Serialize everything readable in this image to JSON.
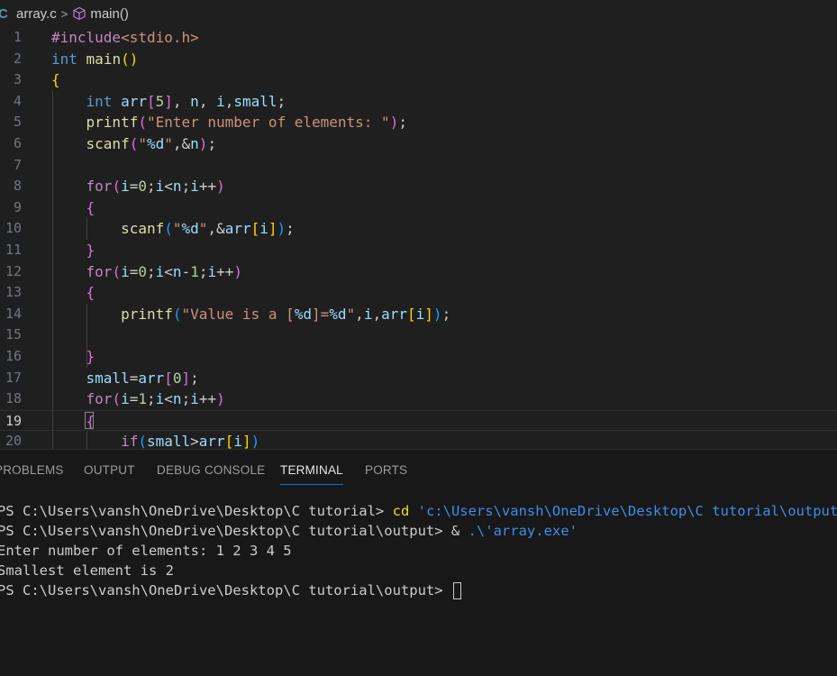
{
  "breadcrumb": {
    "lang_icon": "C",
    "file": "array.c",
    "separator": ">",
    "symbol_icon": "cube-icon",
    "symbol": "main()"
  },
  "editor": {
    "current_line": 19,
    "lines": [
      {
        "n": "1"
      },
      {
        "n": "2"
      },
      {
        "n": "3"
      },
      {
        "n": "4"
      },
      {
        "n": "5"
      },
      {
        "n": "6"
      },
      {
        "n": "7"
      },
      {
        "n": "8"
      },
      {
        "n": "9"
      },
      {
        "n": "10"
      },
      {
        "n": "11"
      },
      {
        "n": "12"
      },
      {
        "n": "13"
      },
      {
        "n": "14"
      },
      {
        "n": "15"
      },
      {
        "n": "16"
      },
      {
        "n": "17"
      },
      {
        "n": "18"
      },
      {
        "n": "19"
      },
      {
        "n": "20"
      }
    ],
    "code": [
      [
        {
          "t": "#include",
          "c": "pp"
        },
        {
          "t": "<stdio.h>",
          "c": "str"
        }
      ],
      [
        {
          "t": "int",
          "c": "kw"
        },
        {
          "t": " "
        },
        {
          "t": "main",
          "c": "fn"
        },
        {
          "t": "()",
          "c": "p1"
        }
      ],
      [
        {
          "t": "{",
          "c": "p1"
        }
      ],
      [
        {
          "t": "    "
        },
        {
          "t": "int",
          "c": "kw"
        },
        {
          "t": " "
        },
        {
          "t": "arr",
          "c": "var"
        },
        {
          "t": "[",
          "c": "p2"
        },
        {
          "t": "5",
          "c": "num"
        },
        {
          "t": "]",
          "c": "p2"
        },
        {
          "t": ", "
        },
        {
          "t": "n",
          "c": "var"
        },
        {
          "t": ", "
        },
        {
          "t": "i",
          "c": "var"
        },
        {
          "t": ","
        },
        {
          "t": "small",
          "c": "var"
        },
        {
          "t": ";"
        }
      ],
      [
        {
          "t": "    "
        },
        {
          "t": "printf",
          "c": "fn"
        },
        {
          "t": "(",
          "c": "p2"
        },
        {
          "t": "\"Enter number of elements: \"",
          "c": "str"
        },
        {
          "t": ")",
          "c": "p2"
        },
        {
          "t": ";"
        }
      ],
      [
        {
          "t": "    "
        },
        {
          "t": "scanf",
          "c": "fn"
        },
        {
          "t": "(",
          "c": "p2"
        },
        {
          "t": "\"",
          "c": "str"
        },
        {
          "t": "%d",
          "c": "esc"
        },
        {
          "t": "\"",
          "c": "str"
        },
        {
          "t": ",&"
        },
        {
          "t": "n",
          "c": "var"
        },
        {
          "t": ")",
          "c": "p2"
        },
        {
          "t": ";"
        }
      ],
      [],
      [
        {
          "t": "    "
        },
        {
          "t": "for",
          "c": "pp"
        },
        {
          "t": "(",
          "c": "p2"
        },
        {
          "t": "i",
          "c": "var"
        },
        {
          "t": "="
        },
        {
          "t": "0",
          "c": "num"
        },
        {
          "t": ";"
        },
        {
          "t": "i",
          "c": "var"
        },
        {
          "t": "<"
        },
        {
          "t": "n",
          "c": "var"
        },
        {
          "t": ";"
        },
        {
          "t": "i",
          "c": "var"
        },
        {
          "t": "++"
        },
        {
          "t": ")",
          "c": "p2"
        }
      ],
      [
        {
          "t": "    "
        },
        {
          "t": "{",
          "c": "p2"
        }
      ],
      [
        {
          "t": "        "
        },
        {
          "t": "scanf",
          "c": "fn"
        },
        {
          "t": "(",
          "c": "p3"
        },
        {
          "t": "\"",
          "c": "str"
        },
        {
          "t": "%d",
          "c": "esc"
        },
        {
          "t": "\"",
          "c": "str"
        },
        {
          "t": ",&"
        },
        {
          "t": "arr",
          "c": "var"
        },
        {
          "t": "[",
          "c": "p1"
        },
        {
          "t": "i",
          "c": "var"
        },
        {
          "t": "]",
          "c": "p1"
        },
        {
          "t": ")",
          "c": "p3"
        },
        {
          "t": ";"
        }
      ],
      [
        {
          "t": "    "
        },
        {
          "t": "}",
          "c": "p2"
        }
      ],
      [
        {
          "t": "    "
        },
        {
          "t": "for",
          "c": "pp"
        },
        {
          "t": "(",
          "c": "p2"
        },
        {
          "t": "i",
          "c": "var"
        },
        {
          "t": "="
        },
        {
          "t": "0",
          "c": "num"
        },
        {
          "t": ";"
        },
        {
          "t": "i",
          "c": "var"
        },
        {
          "t": "<"
        },
        {
          "t": "n",
          "c": "var"
        },
        {
          "t": "-"
        },
        {
          "t": "1",
          "c": "num"
        },
        {
          "t": ";"
        },
        {
          "t": "i",
          "c": "var"
        },
        {
          "t": "++"
        },
        {
          "t": ")",
          "c": "p2"
        }
      ],
      [
        {
          "t": "    "
        },
        {
          "t": "{",
          "c": "p2"
        }
      ],
      [
        {
          "t": "        "
        },
        {
          "t": "printf",
          "c": "fn"
        },
        {
          "t": "(",
          "c": "p3"
        },
        {
          "t": "\"Value is a [",
          "c": "str"
        },
        {
          "t": "%d",
          "c": "esc"
        },
        {
          "t": "]=",
          "c": "str"
        },
        {
          "t": "%d",
          "c": "esc"
        },
        {
          "t": "\"",
          "c": "str"
        },
        {
          "t": ","
        },
        {
          "t": "i",
          "c": "var"
        },
        {
          "t": ","
        },
        {
          "t": "arr",
          "c": "var"
        },
        {
          "t": "[",
          "c": "p1"
        },
        {
          "t": "i",
          "c": "var"
        },
        {
          "t": "]",
          "c": "p1"
        },
        {
          "t": ")",
          "c": "p3"
        },
        {
          "t": ";"
        }
      ],
      [],
      [
        {
          "t": "    "
        },
        {
          "t": "}",
          "c": "p2"
        }
      ],
      [
        {
          "t": "    "
        },
        {
          "t": "small",
          "c": "var"
        },
        {
          "t": "="
        },
        {
          "t": "arr",
          "c": "var"
        },
        {
          "t": "[",
          "c": "p2"
        },
        {
          "t": "0",
          "c": "num"
        },
        {
          "t": "]",
          "c": "p2"
        },
        {
          "t": ";"
        }
      ],
      [
        {
          "t": "    "
        },
        {
          "t": "for",
          "c": "pp"
        },
        {
          "t": "(",
          "c": "p2"
        },
        {
          "t": "i",
          "c": "var"
        },
        {
          "t": "="
        },
        {
          "t": "1",
          "c": "num"
        },
        {
          "t": ";"
        },
        {
          "t": "i",
          "c": "var"
        },
        {
          "t": "<"
        },
        {
          "t": "n",
          "c": "var"
        },
        {
          "t": ";"
        },
        {
          "t": "i",
          "c": "var"
        },
        {
          "t": "++"
        },
        {
          "t": ")",
          "c": "p2"
        }
      ],
      [
        {
          "t": "    "
        },
        {
          "t": "{",
          "c": "p2"
        }
      ],
      [
        {
          "t": "        "
        },
        {
          "t": "if",
          "c": "pp"
        },
        {
          "t": "(",
          "c": "p3"
        },
        {
          "t": "small",
          "c": "var"
        },
        {
          "t": ">"
        },
        {
          "t": "arr",
          "c": "var"
        },
        {
          "t": "[",
          "c": "p1"
        },
        {
          "t": "i",
          "c": "var"
        },
        {
          "t": "]",
          "c": "p1"
        },
        {
          "t": ")",
          "c": "p3"
        }
      ]
    ]
  },
  "panel": {
    "tabs": [
      {
        "label": "PROBLEMS",
        "name": "tab-problems"
      },
      {
        "label": "OUTPUT",
        "name": "tab-output"
      },
      {
        "label": "DEBUG CONSOLE",
        "name": "tab-debug-console"
      },
      {
        "label": "TERMINAL",
        "name": "tab-terminal",
        "active": true
      },
      {
        "label": "PORTS",
        "name": "tab-ports"
      }
    ],
    "terminal": {
      "line1_prompt": "PS C:\\Users\\vansh\\OneDrive\\Desktop\\C tutorial> ",
      "line1_cmd": "cd",
      "line1_arg": " 'c:\\Users\\vansh\\OneDrive\\Desktop\\C tutorial\\output'",
      "line2_prompt": "PS C:\\Users\\vansh\\OneDrive\\Desktop\\C tutorial\\output> ",
      "line2_op": "& ",
      "line2_arg": ".\\'array.exe'",
      "line3": "Enter number of elements: 1 2 3 4 5",
      "line4": "Smallest element is 2",
      "line5_prompt": "PS C:\\Users\\vansh\\OneDrive\\Desktop\\C tutorial\\output> "
    }
  },
  "colors": {
    "background": "#1f1f1f",
    "panel_background": "#181818",
    "active_tab_underline": "#0078d4"
  }
}
